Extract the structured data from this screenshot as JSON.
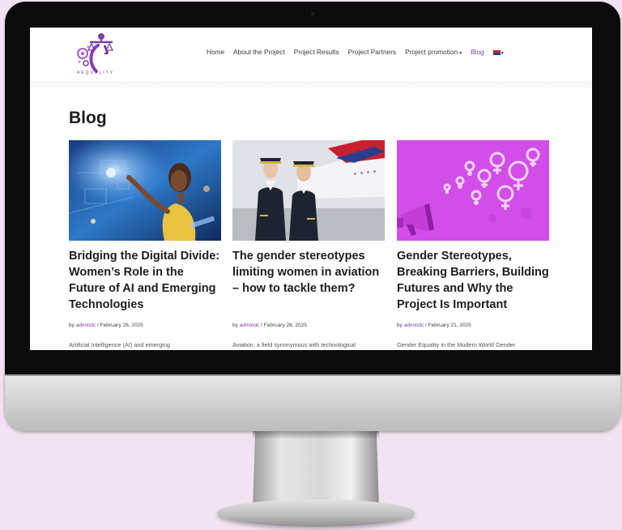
{
  "logo": {
    "text": "AEQUALITY"
  },
  "nav": {
    "items": [
      {
        "label": "Home",
        "active": false
      },
      {
        "label": "About the Project",
        "active": false
      },
      {
        "label": "Project Results",
        "active": false
      },
      {
        "label": "Project Partners",
        "active": false
      },
      {
        "label": "Project promotion",
        "active": false,
        "dropdown": true
      },
      {
        "label": "Blog",
        "active": true
      },
      {
        "label": "",
        "icon": "uk-flag-icon",
        "dropdown": true
      }
    ]
  },
  "page": {
    "title": "Blog"
  },
  "posts": [
    {
      "title": "Bridging the Digital Divide: Women’s Role in the Future of AI and Emerging Technologies",
      "by": "by",
      "author": "admindc",
      "sep": " / ",
      "date": "February 26, 2025",
      "excerpt": "Artificial Intelligence (AI) and emerging"
    },
    {
      "title": "The gender stereotypes limiting women in aviation – how to tackle them?",
      "by": "by",
      "author": "admindc",
      "sep": " / ",
      "date": "February 26, 2025",
      "excerpt": "Aviation, a field synonymous with technological"
    },
    {
      "title": "Gender Stereotypes, Breaking Barriers, Building Futures and Why the Project Is Important",
      "by": "by",
      "author": "admindc",
      "sep": " / ",
      "date": "February 21, 2025",
      "excerpt": "Gender Equality in the Modern World Gender"
    }
  ],
  "colors": {
    "accent": "#7b3fa0",
    "background": "#f1e3f1",
    "magenta_card": "#d24ee8"
  }
}
